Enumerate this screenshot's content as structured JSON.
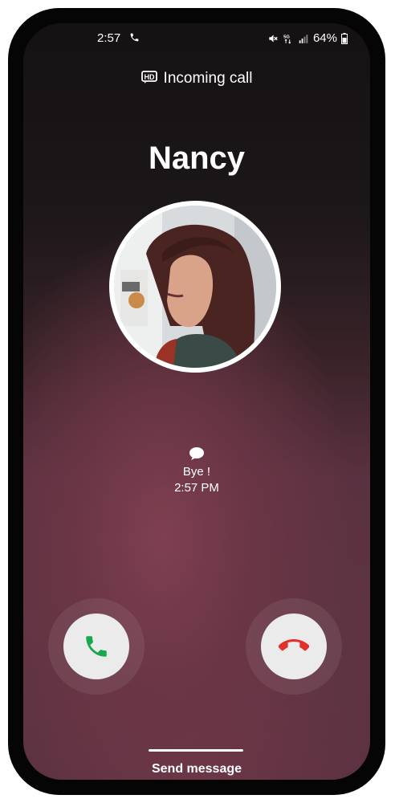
{
  "status_bar": {
    "time": "2:57",
    "battery_percent": "64%",
    "icons": [
      "phone-call-icon",
      "mute-icon",
      "5g-icon",
      "signal-icon",
      "battery-icon"
    ]
  },
  "call": {
    "type_label": "Incoming call",
    "type_icon": "hd-icon",
    "caller_name": "Nancy"
  },
  "message": {
    "icon": "message-bubble-icon",
    "text": "Bye !",
    "time": "2:57 PM"
  },
  "actions": {
    "answer_icon": "phone-answer-icon",
    "decline_icon": "phone-decline-icon",
    "answer_color": "#1aa84f",
    "decline_color": "#e0312b",
    "send_message_label": "Send message"
  }
}
